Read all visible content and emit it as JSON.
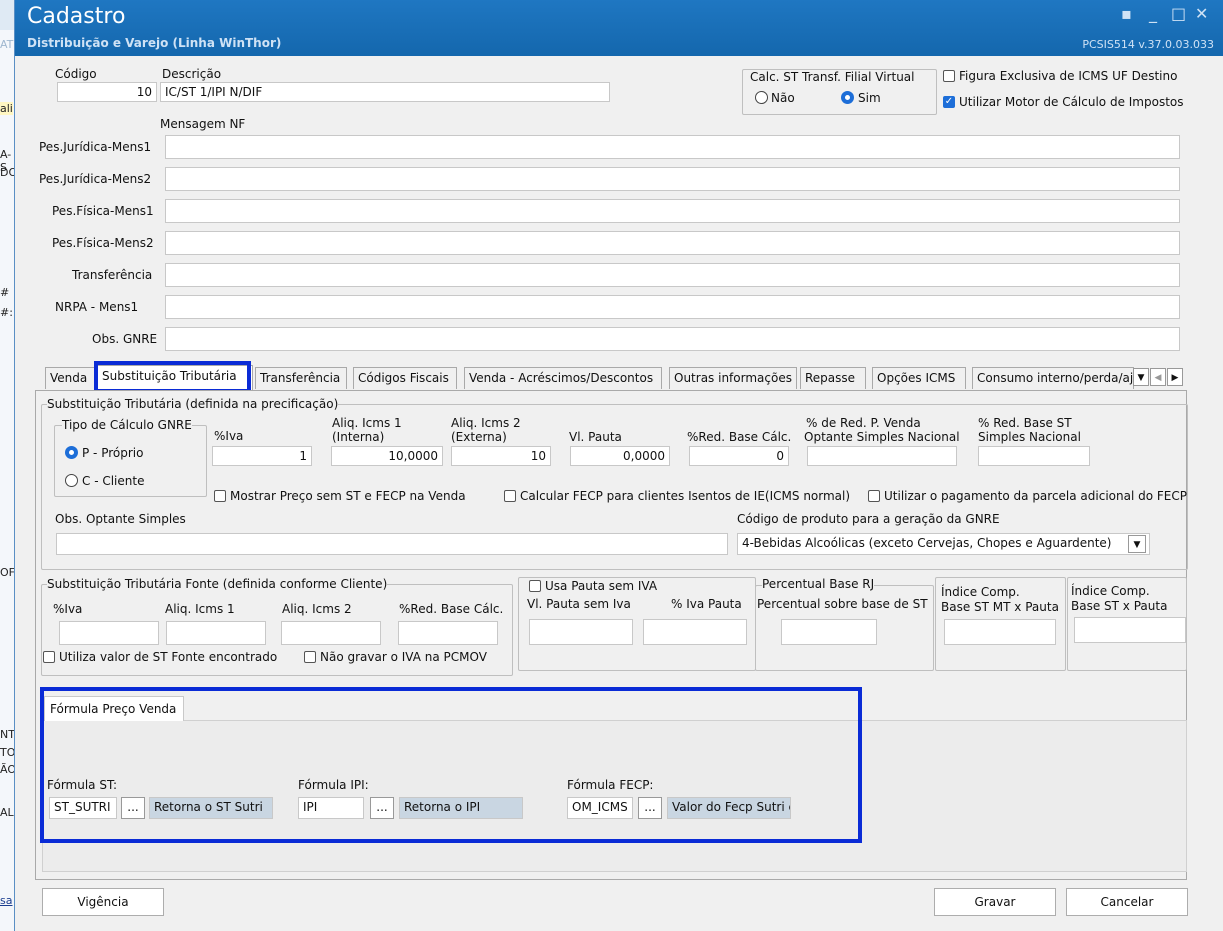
{
  "window": {
    "title": "Cadastro",
    "subtitle": "Distribuição e Varejo (Linha WinThor)",
    "version": "PCSIS514  v.37.0.03.033"
  },
  "bg": {
    "frag1": "AT",
    "frag2": "ali",
    "frag3": "A-S",
    "frag4": "DO",
    "frag5": "#",
    "frag6": "#:",
    "frag7": "OF",
    "frag8": "NT",
    "frag9": "TO",
    "frag10": "ÃO",
    "frag11": "AL",
    "frag12": "sa"
  },
  "header": {
    "codigo_label": "Código",
    "codigo_value": "10",
    "descricao_label": "Descrição",
    "descricao_value": "IC/ST 1/IPI N/DIF",
    "calc_st_label": "Calc. ST Transf. Filial Virtual",
    "opt_nao": "Não",
    "opt_sim": "Sim",
    "figura_label": "Figura Exclusiva de ICMS UF Destino",
    "motor_label": "Utilizar Motor de Cálculo de Impostos",
    "mensagem_label": "Mensagem NF"
  },
  "messages": [
    {
      "label": "Pes.Jurídica-Mens1",
      "value": ""
    },
    {
      "label": "Pes.Jurídica-Mens2",
      "value": ""
    },
    {
      "label": "Pes.Física-Mens1",
      "value": ""
    },
    {
      "label": "Pes.Física-Mens2",
      "value": ""
    },
    {
      "label": "Transferência",
      "value": ""
    },
    {
      "label": "NRPA - Mens1",
      "value": ""
    },
    {
      "label": "Obs. GNRE",
      "value": ""
    }
  ],
  "tabs": [
    "Venda",
    "Substituição Tributária",
    "Transferência",
    "Códigos Fiscais",
    "Venda - Acréscimos/Descontos",
    "Outras informações",
    "Repasse",
    "Opções ICMS",
    "Consumo interno/perda/ajuste"
  ],
  "st": {
    "group_title": "Substituição Tributária (definida na precificação)",
    "tipo_title": "Tipo de Cálculo GNRE",
    "opt_p": "P - Próprio",
    "opt_c": "C - Cliente",
    "iva_label": "%Iva",
    "iva_value": "1",
    "aliq1_label1": "Aliq. Icms 1",
    "aliq1_label2": "(Interna)",
    "aliq1_value": "10,0000",
    "aliq2_label1": "Aliq. Icms 2",
    "aliq2_label2": "(Externa)",
    "aliq2_value": "10",
    "pauta_label": "Vl. Pauta",
    "pauta_value": "0,0000",
    "redbase_label": "%Red. Base Cálc.",
    "redbase_value": "0",
    "redvenda_label1": "% de Red. P. Venda",
    "redvenda_label2": "Optante Simples Nacional",
    "redvenda_value": "",
    "redst_label1": "% Red. Base ST",
    "redst_label2": "Simples Nacional",
    "redst_value": "",
    "chk_mostrar": "Mostrar Preço sem ST e FECP na Venda",
    "chk_fecp": "Calcular FECP para clientes Isentos de IE(ICMS normal)",
    "chk_parcela": "Utilizar o pagamento da parcela adicional do FECP",
    "obs_label": "Obs. Optante Simples",
    "obs_value": "",
    "gnre_label": "Código de produto para a geração da GNRE",
    "gnre_value": "4-Bebidas Alcoólicas (exceto Cervejas, Chopes e Aguardente)"
  },
  "stf": {
    "group_title": "Substituição Tributária Fonte (definida conforme Cliente)",
    "iva": "%Iva",
    "aliq1": "Aliq. Icms 1",
    "aliq2": "Aliq. Icms 2",
    "redbase": "%Red. Base Cálc.",
    "chk_utiliza": "Utiliza valor de ST Fonte encontrado",
    "chk_naogravar": "Não gravar o IVA na PCMOV",
    "usa_pauta": "Usa Pauta sem IVA",
    "vl_pauta": "Vl. Pauta sem Iva",
    "iva_pauta": "% Iva Pauta",
    "rj_title": "Percentual Base RJ",
    "rj_label": "Percentual sobre base de ST",
    "idx_mt1": "Índice Comp.",
    "idx_mt2": "Base ST MT x Pauta",
    "idx1": "Índice Comp.",
    "idx2": "Base ST x Pauta"
  },
  "formula": {
    "tab": "Fórmula Preço Venda",
    "st_label": "Fórmula ST:",
    "st_value": "ST_SUTRI",
    "st_desc": "Retorna o ST Sutri",
    "ipi_label": "Fórmula IPI:",
    "ipi_value": "IPI",
    "ipi_desc": "Retorna o IPI",
    "fecp_label": "Fórmula FECP:",
    "fecp_value": "OM_ICMS",
    "fecp_desc": "Valor do Fecp Sutri c",
    "ellipsis": "..."
  },
  "footer": {
    "vigencia": "Vigência",
    "gravar": "Gravar",
    "cancelar": "Cancelar"
  },
  "colors": {
    "title_bg": "#1467ad",
    "highlight": "#0a2bd6",
    "checked": "#1d6ed8"
  }
}
